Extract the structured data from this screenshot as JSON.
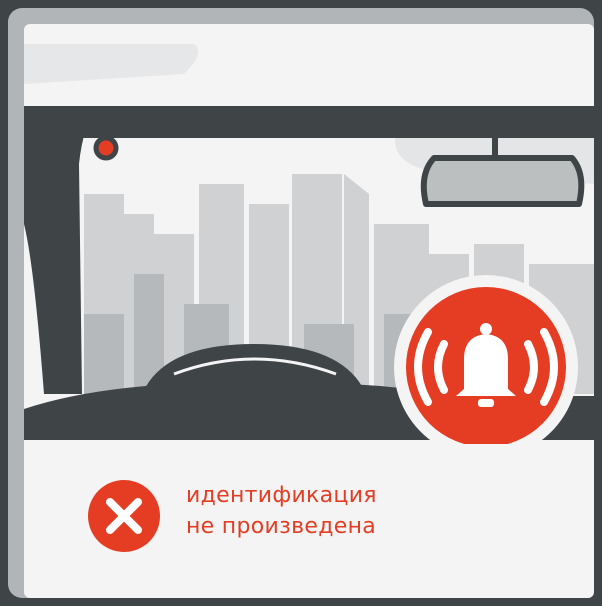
{
  "status": {
    "line1": "идентификация",
    "line2": "не произведена",
    "color": "#e43d23"
  },
  "icons": {
    "status_icon": "error-x-icon",
    "alarm_icon": "alarm-bell-icon"
  },
  "colors": {
    "background": "#3f4447",
    "frame": "#b2b5b7",
    "panel": "#f4f4f4",
    "vehicle": "#3f4447",
    "city": "#c9cbcc",
    "accent": "#e43d23"
  }
}
